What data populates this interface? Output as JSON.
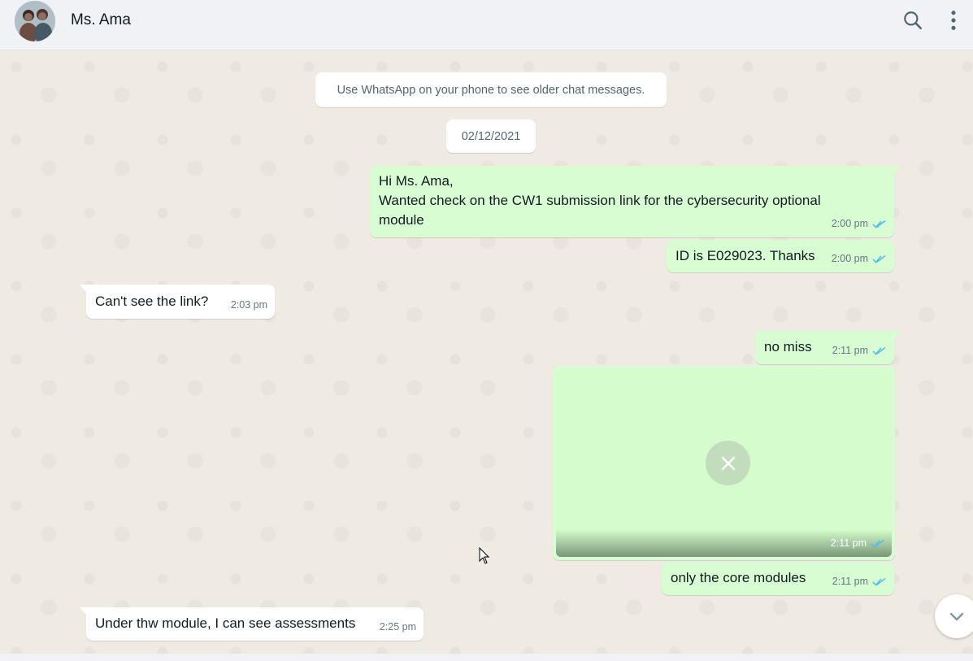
{
  "header": {
    "contact_name": "Ms. Ama",
    "icons": {
      "search": "search-icon",
      "menu": "kebab-menu-icon"
    }
  },
  "system": {
    "older_notice": "Use WhatsApp on your phone to see older chat messages.",
    "date": "02/12/2021"
  },
  "messages": [
    {
      "direction": "out",
      "text_line1": "Hi Ms. Ama,",
      "text_line2": "Wanted check on the CW1 submission link for the cybersecurity optional module",
      "time": "2:00 pm",
      "status": "read"
    },
    {
      "direction": "out",
      "text": "ID is E029023. Thanks",
      "time": "2:00 pm",
      "status": "read"
    },
    {
      "direction": "in",
      "text": "Can't see the link?",
      "time": "2:03 pm"
    },
    {
      "direction": "out",
      "text": "no miss",
      "time": "2:11 pm",
      "status": "read"
    },
    {
      "direction": "out",
      "type": "image",
      "time": "2:11 pm",
      "status": "read",
      "icon": "close-icon"
    },
    {
      "direction": "out",
      "text": "only the core modules",
      "time": "2:11 pm",
      "status": "read"
    },
    {
      "direction": "in",
      "text": "Under thw module, I can see assessments",
      "time": "2:25 pm"
    }
  ],
  "colors": {
    "outgoing": "#d9fdd3",
    "incoming": "#ffffff",
    "read_ticks": "#53bdeb",
    "background": "#efeae2"
  }
}
